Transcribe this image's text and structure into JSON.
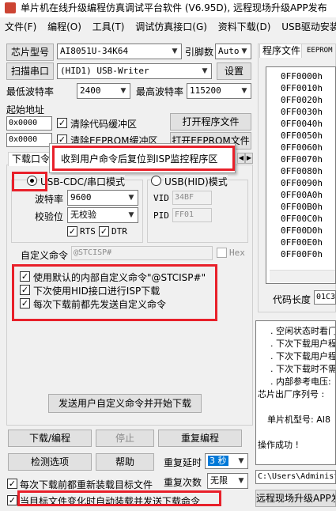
{
  "title": {
    "text": "单片机在线升级编程仿真调试平台软件 (V6.95D), 远程现场升级APP发布"
  },
  "menu": [
    "文件(F)",
    "编程(O)",
    "工具(T)",
    "调试仿真接口(G)",
    "资料下载(D)",
    "USB驱动安装(U)"
  ],
  "chip": {
    "button": "芯片型号",
    "value": "AI8051U-34K64",
    "pins_label": "引脚数",
    "pins_value": "Auto"
  },
  "scan": {
    "button": "扫描串口",
    "value": "(HID1) USB-Writer",
    "settings_button": "设置"
  },
  "baud": {
    "min_label": "最低波特率",
    "min_value": "2400",
    "max_label": "最高波特率",
    "max_value": "115200"
  },
  "start_addr": {
    "label": "起始地址",
    "code_value": "0x0000",
    "clear_code_label": "清除代码缓冲区",
    "open_program_button": "打开程序文件",
    "eeprom_value": "0x0000",
    "clear_eeprom_label": "清除EEPROM缓冲区",
    "open_eeprom_button": "打开EEPROM文件"
  },
  "download_tab_label": "下载口令",
  "tooltip": "收到用户命令后复位到ISP监控程序区",
  "mode": {
    "usb_cdc_label": "USB-CDC/串口模式",
    "usb_hid_label": "USB(HID)模式",
    "baud_label": "波特率",
    "baud_value": "9600",
    "parity_label": "校验位",
    "parity_value": "无校验",
    "vid_label": "VID",
    "vid_value": "34BF",
    "pid_label": "PID",
    "pid_value": "FF01",
    "rts_label": "RTS",
    "dtr_label": "DTR"
  },
  "custom": {
    "label": "自定义命令",
    "value": "@STCISP#",
    "hex_label": "Hex",
    "opt1": "使用默认的内部自定义命令\"@STCISP#\"",
    "opt2": "下次使用HID接口进行ISP下载",
    "opt3": "每次下载前都先发送自定义命令",
    "send_button": "发送用户自定义命令并开始下载"
  },
  "actions": {
    "download_button": "下载/编程",
    "stop_button": "停止",
    "reprogram_button": "重复编程",
    "check_button": "检测选项",
    "help_button": "帮助",
    "delay_label": "重复延时",
    "delay_value": "3 秒",
    "count_label": "重复次数",
    "count_value": "无限",
    "reload_label": "每次下载前都重新装载目标文件",
    "auto_label": "当目标文件变化时自动装载并发送下载命令"
  },
  "right": {
    "tab_program": "程序文件",
    "tab_eeprom": "EEPROM",
    "addresses": [
      "0FF0000h",
      "0FF0010h",
      "0FF0020h",
      "0FF0030h",
      "0FF0040h",
      "0FF0050h",
      "0FF0060h",
      "0FF0070h",
      "0FF0080h",
      "0FF0090h",
      "0FF00A0h",
      "0FF00B0h",
      "0FF00C0h",
      "0FF00D0h",
      "0FF00E0h",
      "0FF00F0h"
    ],
    "code_len_label": "代码长度",
    "code_len_value": "01C3",
    "info_lines": [
      ". 空闲状态时看门",
      ". 下次下载用户程",
      ". 下次下载用户程",
      ". 下次下载时不需",
      ". 内部参考电压:",
      "芯片出厂序列号 :",
      "",
      "单片机型号: AI8",
      "",
      "操作成功 !"
    ],
    "path_value": "C:\\Users\\Administ",
    "remote_button": "远程现场升级APP发布"
  },
  "colors": {
    "highlight": "#e8202a",
    "selection": "#0078d7"
  }
}
